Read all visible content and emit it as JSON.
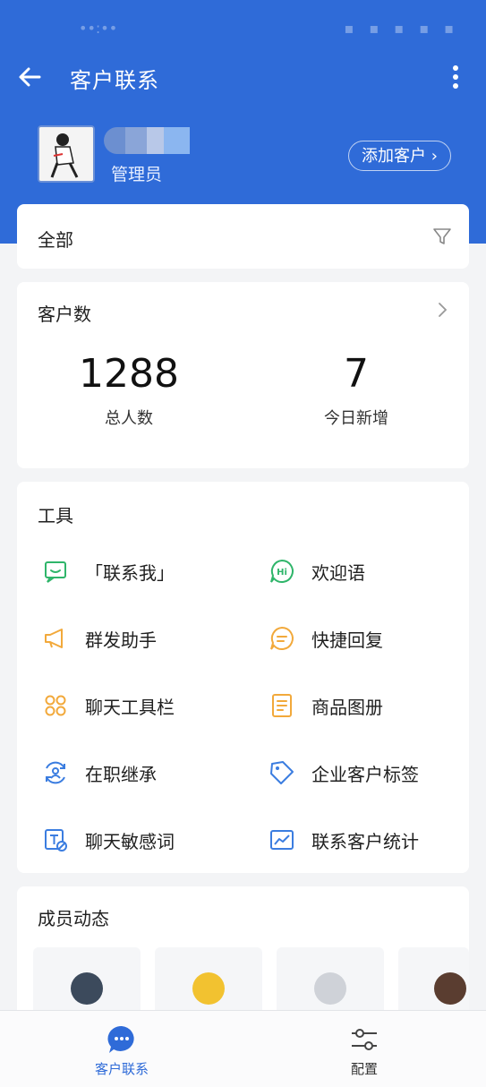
{
  "nav": {
    "title": "客户联系"
  },
  "profile": {
    "role": "管理员",
    "add_customer_label": "添加客户 ›"
  },
  "filter": {
    "label": "全部"
  },
  "customer_count": {
    "title": "客户数",
    "total_value": "1288",
    "total_label": "总人数",
    "today_value": "7",
    "today_label": "今日新增"
  },
  "tools": {
    "title": "工具",
    "items": [
      {
        "label": "「联系我」",
        "icon": "contact-me-icon",
        "color": "#2fb56a"
      },
      {
        "label": "欢迎语",
        "icon": "hi-greeting-icon",
        "color": "#2fb56a"
      },
      {
        "label": "群发助手",
        "icon": "megaphone-icon",
        "color": "#f2a93b"
      },
      {
        "label": "快捷回复",
        "icon": "quick-reply-icon",
        "color": "#f2a93b"
      },
      {
        "label": "聊天工具栏",
        "icon": "toolbar-icon",
        "color": "#f2a93b"
      },
      {
        "label": "商品图册",
        "icon": "catalog-icon",
        "color": "#f2a93b"
      },
      {
        "label": "在职继承",
        "icon": "inherit-icon",
        "color": "#3b7de0"
      },
      {
        "label": "企业客户标签",
        "icon": "tag-icon",
        "color": "#3b7de0"
      },
      {
        "label": "聊天敏感词",
        "icon": "sensitive-word-icon",
        "color": "#3b7de0"
      },
      {
        "label": "联系客户统计",
        "icon": "statistics-icon",
        "color": "#3b7de0"
      }
    ]
  },
  "members": {
    "title": "成员动态"
  },
  "tabbar": {
    "contacts_label": "客户联系",
    "config_label": "配置"
  },
  "colors": {
    "brand": "#2f6bd8",
    "green": "#2fb56a",
    "orange": "#f2a93b",
    "blue": "#3b7de0"
  }
}
